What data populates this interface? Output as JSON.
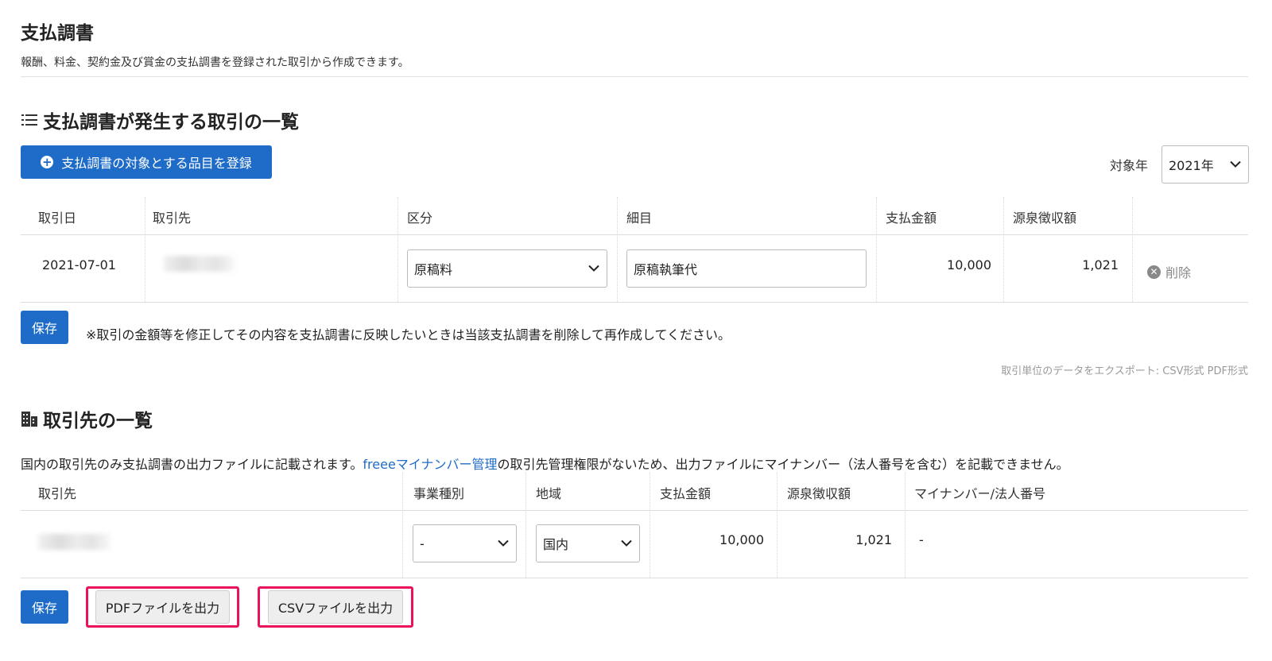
{
  "page": {
    "title": "支払調書",
    "description": "報酬、料金、契約金及び賞金の支払調書を登録された取引から作成できます。"
  },
  "transactions_section": {
    "title": "支払調書が発生する取引の一覧",
    "icon": "list-icon",
    "add_button_label": "支払調書の対象とする品目を登録",
    "year_label": "対象年",
    "year_value": "2021年",
    "columns": [
      "取引日",
      "取引先",
      "区分",
      "細目",
      "支払金額",
      "源泉徴収額"
    ],
    "rows": [
      {
        "date": "2021-07-01",
        "partner": "",
        "category": "原稿料",
        "detail": "原稿執筆代",
        "payment": "10,000",
        "withholding": "1,021",
        "delete_label": "削除"
      }
    ],
    "save_label": "保存",
    "note": "※取引の金額等を修正してその内容を支払調書に反映したいときは当該支払調書を削除して再作成してください。",
    "export_text": "取引単位のデータをエクスポート: CSV形式 PDF形式"
  },
  "partners_section": {
    "title": "取引先の一覧",
    "icon": "building-icon",
    "info_before": "国内の取引先のみ支払調書の出力ファイルに記載されます。",
    "info_link": "freeeマイナンバー管理",
    "info_after": "の取引先管理権限がないため、出力ファイルにマイナンバー（法人番号を含む）を記載できません。",
    "columns": [
      "取引先",
      "事業種別",
      "地域",
      "支払金額",
      "源泉徴収額",
      "マイナンバー/法人番号"
    ],
    "rows": [
      {
        "partner": "",
        "business_type": "-",
        "region": "国内",
        "payment": "10,000",
        "withholding": "1,021",
        "my_number": "-"
      }
    ],
    "save_label": "保存",
    "pdf_button_label": "PDFファイルを出力",
    "csv_button_label": "CSVファイルを出力"
  },
  "colors": {
    "primary": "#1f6cc8",
    "highlight": "#e8135a"
  }
}
